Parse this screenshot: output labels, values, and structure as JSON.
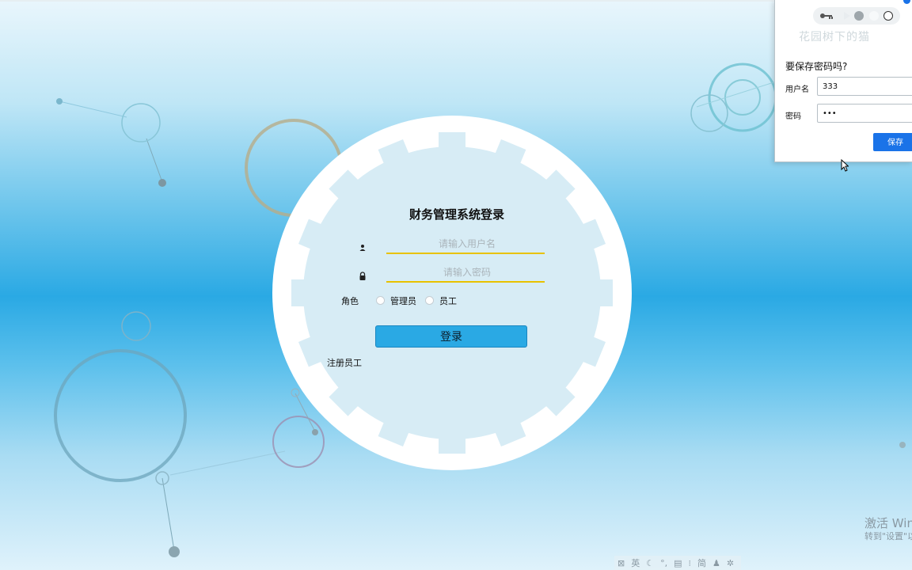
{
  "login": {
    "title": "财务管理系统登录",
    "username_placeholder": "请输入用户名",
    "password_placeholder": "请输入密码",
    "role_label": "角色",
    "role_options": [
      "管理员",
      "员工"
    ],
    "login_button": "登录",
    "register_link": "注册员工"
  },
  "save_password_popup": {
    "title": "要保存密码吗?",
    "username_label": "用户名",
    "username_value": "333",
    "password_label": "密码",
    "password_value": "•••",
    "save_button": "保存",
    "watermark": "花园树下的猫",
    "icons": [
      "key-icon",
      "play-icon",
      "record-icon",
      "circle-icon"
    ]
  },
  "system": {
    "activation_title": "激活 Win",
    "activation_sub": "转到\"设置\"以",
    "ime_items": [
      "英",
      "简"
    ]
  },
  "colors": {
    "accent_blue": "#2aa9e4",
    "field_underline": "#e8c200",
    "save_blue": "#1a73e8"
  }
}
